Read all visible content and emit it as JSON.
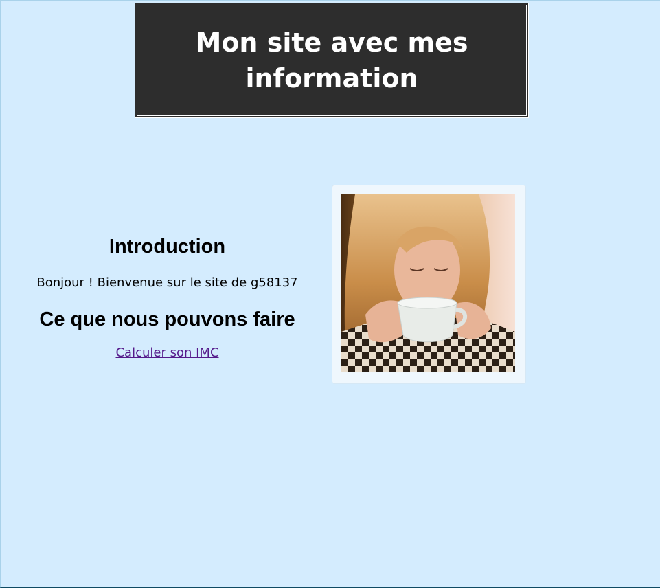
{
  "header": {
    "title": "Mon site avec mes information"
  },
  "main": {
    "intro_heading": "Introduction",
    "intro_text": "Bonjour ! Bienvenue sur le site de g58137",
    "services_heading": "Ce que nous pouvons faire",
    "imc_link": "Calculer son IMC"
  },
  "colors": {
    "page_background": "#d4ecfe",
    "header_background": "#2d2d2d",
    "header_text": "#ffffff",
    "visited_link": "#551a8b"
  }
}
